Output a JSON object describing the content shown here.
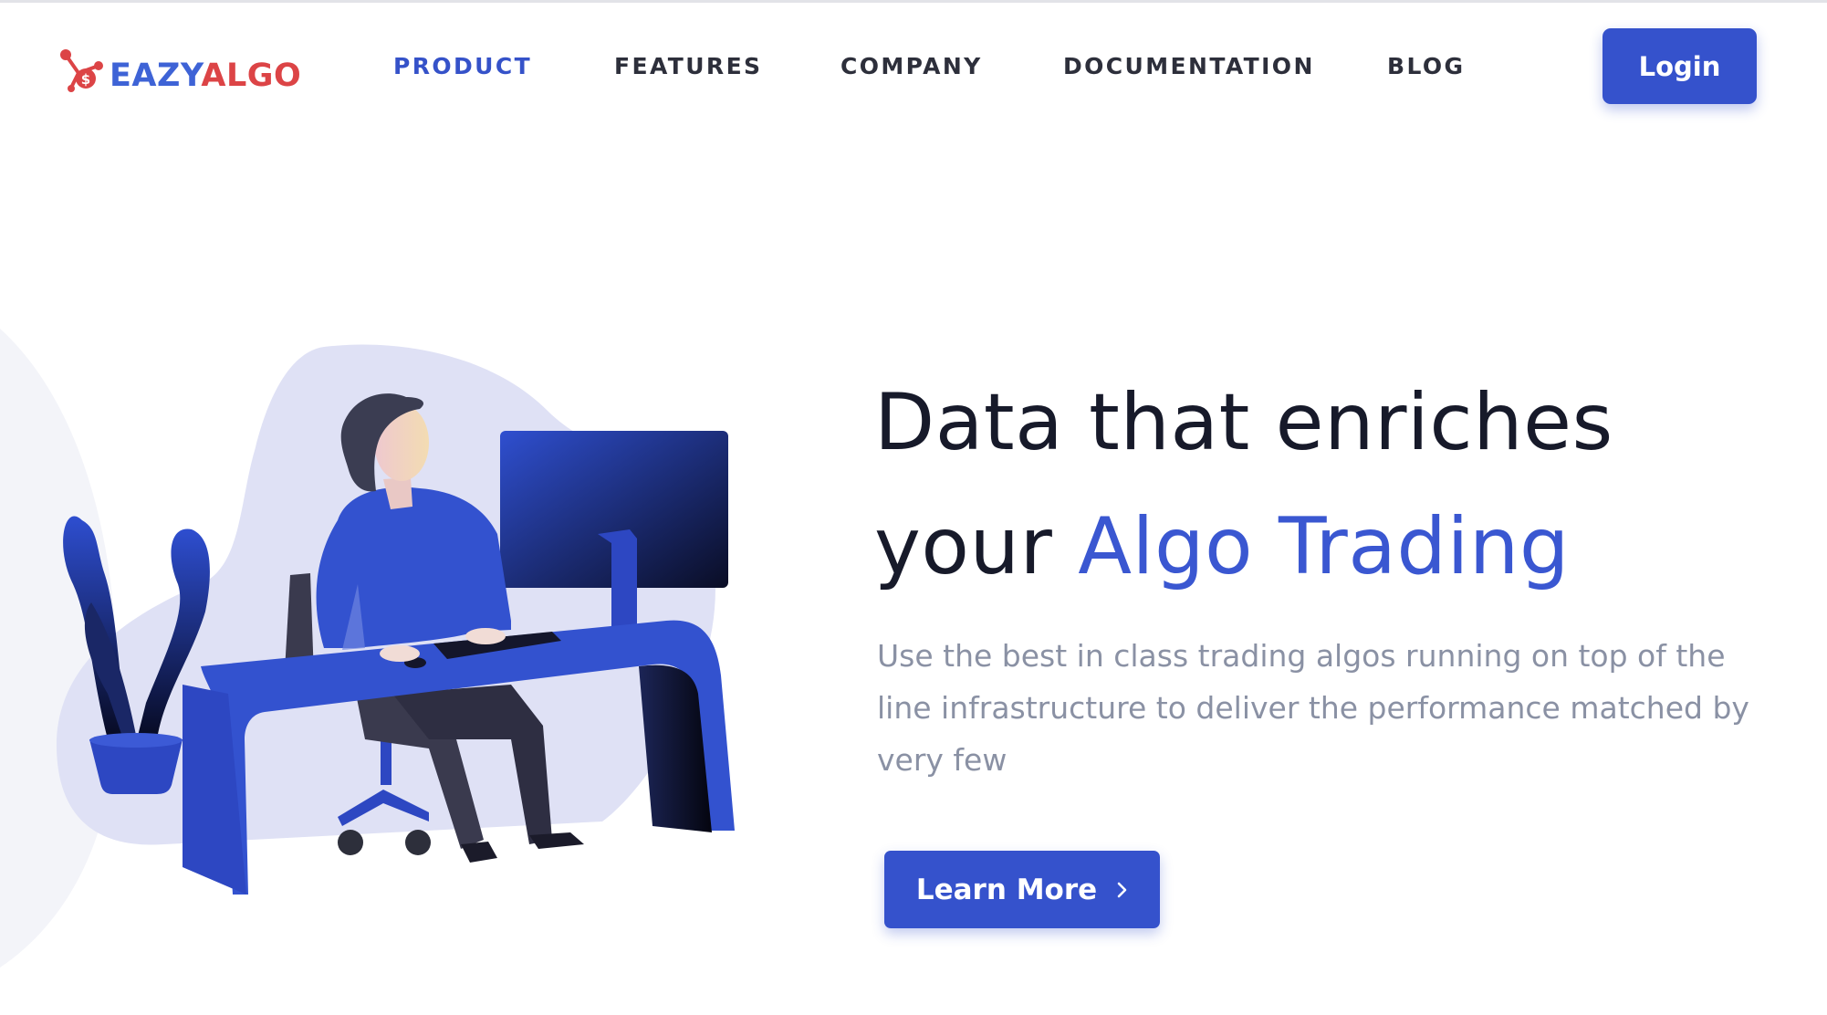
{
  "brand": {
    "logo_part1": "EAZY",
    "logo_part2": "ALGO",
    "colors": {
      "primary": "#3552cc",
      "accent_red": "#dc4446",
      "heading": "#171a2a",
      "muted": "#8a91a4"
    }
  },
  "nav": {
    "items": [
      {
        "label": "PRODUCT",
        "active": true
      },
      {
        "label": "FEATURES",
        "active": false
      },
      {
        "label": "COMPANY",
        "active": false
      },
      {
        "label": "DOCUMENTATION",
        "active": false
      },
      {
        "label": "BLOG",
        "active": false
      }
    ],
    "login_label": "Login"
  },
  "hero": {
    "headline_line1": "Data that enriches",
    "headline_prefix": "your",
    "headline_accent": "Algo Trading",
    "subtext": "Use the best in class trading algos running on top of the line infrastructure to deliver the performance matched by very few",
    "cta_label": "Learn More",
    "cta_icon": "chevron-right-icon",
    "illustration": "person-at-desk-computer-illustration"
  }
}
